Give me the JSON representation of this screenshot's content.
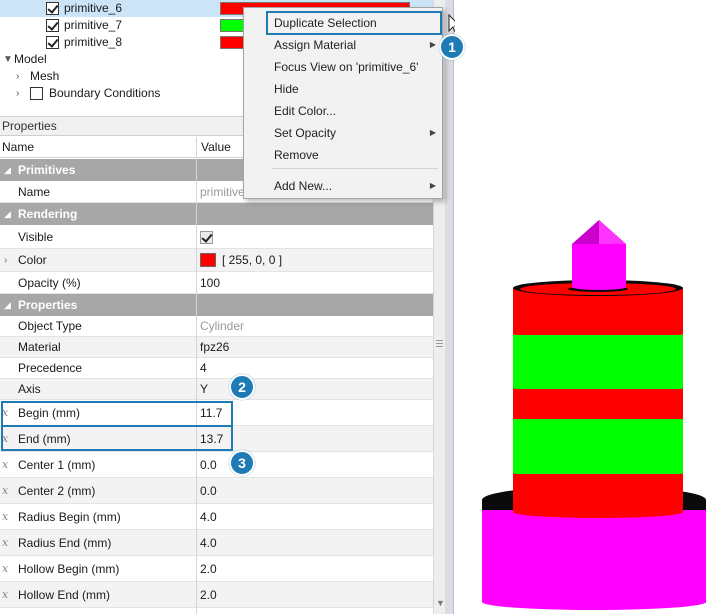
{
  "tree": {
    "items": [
      {
        "label": "primitive_6",
        "checked": true,
        "color": "#ff0000",
        "selected": true
      },
      {
        "label": "primitive_7",
        "checked": true,
        "color": "#00ff00",
        "selected": false
      },
      {
        "label": "primitive_8",
        "checked": true,
        "color": "#ff0000",
        "selected": false
      }
    ],
    "model_label": "Model",
    "mesh_label": "Mesh",
    "boundary_label": "Boundary Conditions"
  },
  "properties": {
    "panel_title": "Properties",
    "col_name": "Name",
    "col_value": "Value",
    "groups": {
      "primitives": "Primitives",
      "rendering": "Rendering",
      "properties": "Properties"
    },
    "rows": {
      "name": {
        "label": "Name",
        "value": "primitive_6"
      },
      "visible": {
        "label": "Visible"
      },
      "color": {
        "label": "Color",
        "value": "[ 255, 0, 0 ]"
      },
      "opacity": {
        "label": "Opacity (%)",
        "value": "100"
      },
      "object_type": {
        "label": "Object Type",
        "value": "Cylinder"
      },
      "material": {
        "label": "Material",
        "value": "fpz26"
      },
      "precedence": {
        "label": "Precedence",
        "value": "4"
      },
      "axis": {
        "label": "Axis",
        "value": "Y"
      },
      "begin": {
        "label": "Begin (mm)",
        "value": "11.7"
      },
      "end": {
        "label": "End (mm)",
        "value": "13.7"
      },
      "center1": {
        "label": "Center 1 (mm)",
        "value": "0.0"
      },
      "center2": {
        "label": "Center 2 (mm)",
        "value": "0.0"
      },
      "radius_begin": {
        "label": "Radius Begin (mm)",
        "value": "4.0"
      },
      "radius_end": {
        "label": "Radius End (mm)",
        "value": "4.0"
      },
      "hollow_begin": {
        "label": "Hollow Begin (mm)",
        "value": "2.0"
      },
      "hollow_end": {
        "label": "Hollow End (mm)",
        "value": "2.0"
      }
    },
    "fx_glyph": "x"
  },
  "context_menu": {
    "items": [
      {
        "label": "Duplicate Selection"
      },
      {
        "label": "Assign Material"
      },
      {
        "label": "Focus View on 'primitive_6'"
      },
      {
        "label": "Hide"
      },
      {
        "label": "Edit Color..."
      },
      {
        "label": "Set Opacity"
      },
      {
        "label": "Remove"
      },
      {
        "label": "Add New..."
      }
    ]
  },
  "callouts": {
    "one": "1",
    "two": "2",
    "three": "3"
  },
  "colors": {
    "accent": "#1f7bb5",
    "red": "#ff0000",
    "green": "#00ff00",
    "magenta": "#ff00ff",
    "group_header": "#a7a7a7"
  }
}
